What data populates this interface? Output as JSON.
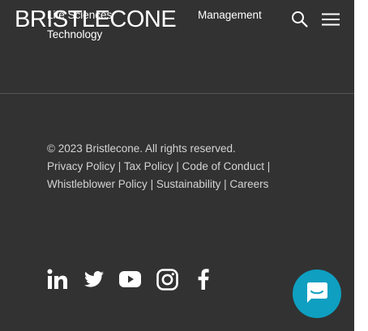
{
  "header": {
    "logo_text": "BRISTLECONE",
    "menu_items": {
      "life_sciences": "Life Sciences",
      "technology": "Technology",
      "management": "Management"
    }
  },
  "footer": {
    "copyright": "© 2023 Bristlecone. All rights reserved.",
    "separator": "|",
    "links": {
      "privacy": "Privacy Policy",
      "tax": "Tax Policy",
      "conduct": "Code of Conduct",
      "whistleblower": "Whistleblower Policy",
      "sustainability": "Sustainability",
      "careers": "Careers"
    }
  },
  "social_icons": [
    "linkedin-icon",
    "twitter-icon",
    "youtube-icon",
    "instagram-icon",
    "facebook-icon"
  ],
  "colors": {
    "background": "#323232",
    "text": "#d4d4d4",
    "chat_button": "#0e9fc1"
  }
}
